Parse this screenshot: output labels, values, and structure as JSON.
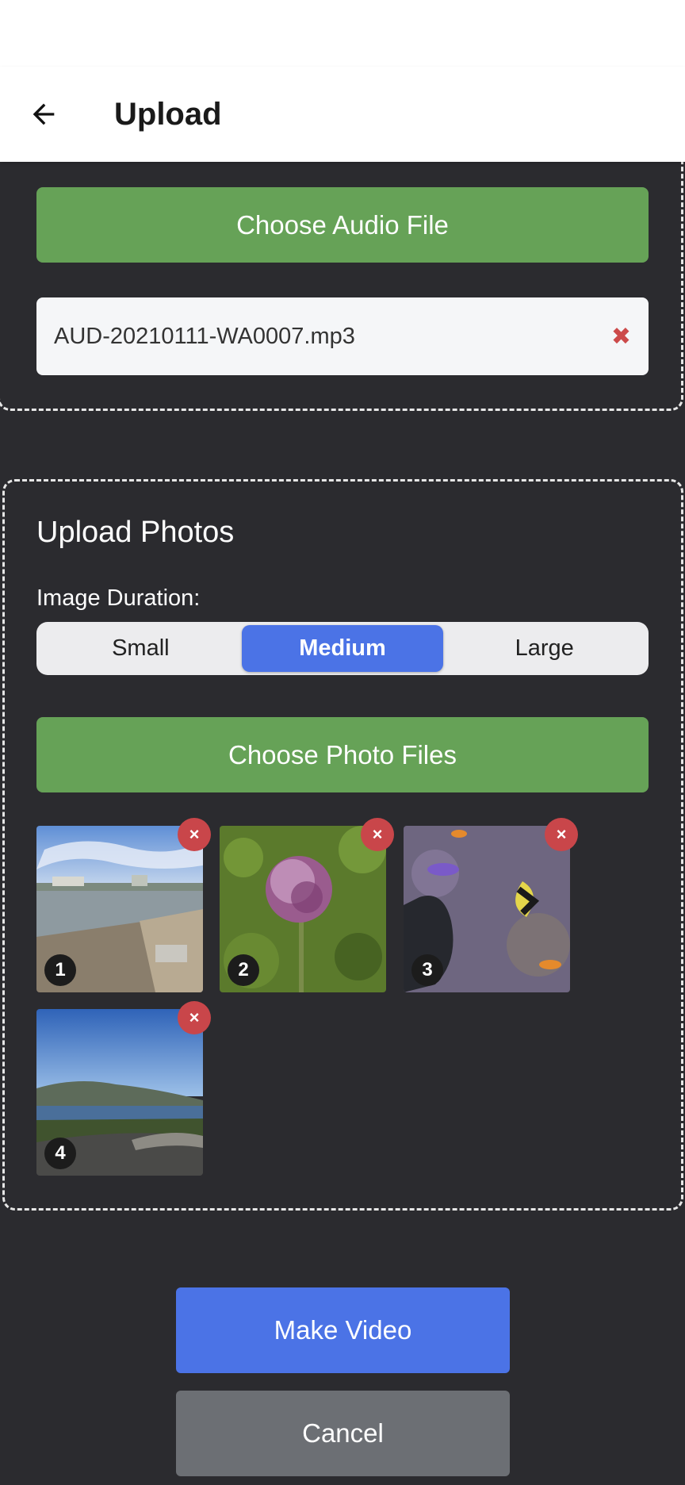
{
  "header": {
    "title": "Upload",
    "back_icon": "arrow-left-icon"
  },
  "audio": {
    "choose_label": "Choose Audio File",
    "file_name": "AUD-20210111-WA0007.mp3",
    "remove_glyph": "✖"
  },
  "photos": {
    "section_title": "Upload Photos",
    "duration_label": "Image Duration:",
    "durations": [
      {
        "label": "Small",
        "active": false
      },
      {
        "label": "Medium",
        "active": true
      },
      {
        "label": "Large",
        "active": false
      }
    ],
    "choose_label": "Choose Photo Files",
    "remove_glyph": "×",
    "items": [
      {
        "number": "1",
        "subject": "lakeshore-photo"
      },
      {
        "number": "2",
        "subject": "purple-allium-flower-photo"
      },
      {
        "number": "3",
        "subject": "aquarium-fish-photo"
      },
      {
        "number": "4",
        "subject": "river-gorge-overlook-photo"
      }
    ]
  },
  "actions": {
    "make_video": "Make Video",
    "cancel": "Cancel"
  },
  "colors": {
    "background": "#2b2b2f",
    "green": "#66a257",
    "blue": "#4b73e6",
    "gray": "#6c6f74",
    "remove_red": "#c9464a"
  }
}
